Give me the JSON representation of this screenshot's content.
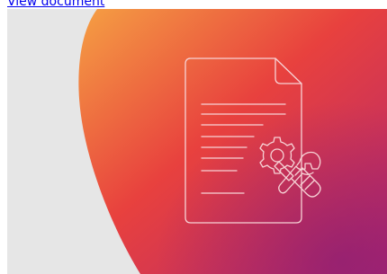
{
  "link": {
    "label": "View document"
  },
  "hero": {
    "icon": "document-settings-icon",
    "alt": "",
    "colors": {
      "background": "#e6e6e6",
      "gradient_start": "#f5a043",
      "gradient_mid": "#e8413e",
      "gradient_end": "#b3266f",
      "line_art": "#f7d3d6"
    }
  }
}
